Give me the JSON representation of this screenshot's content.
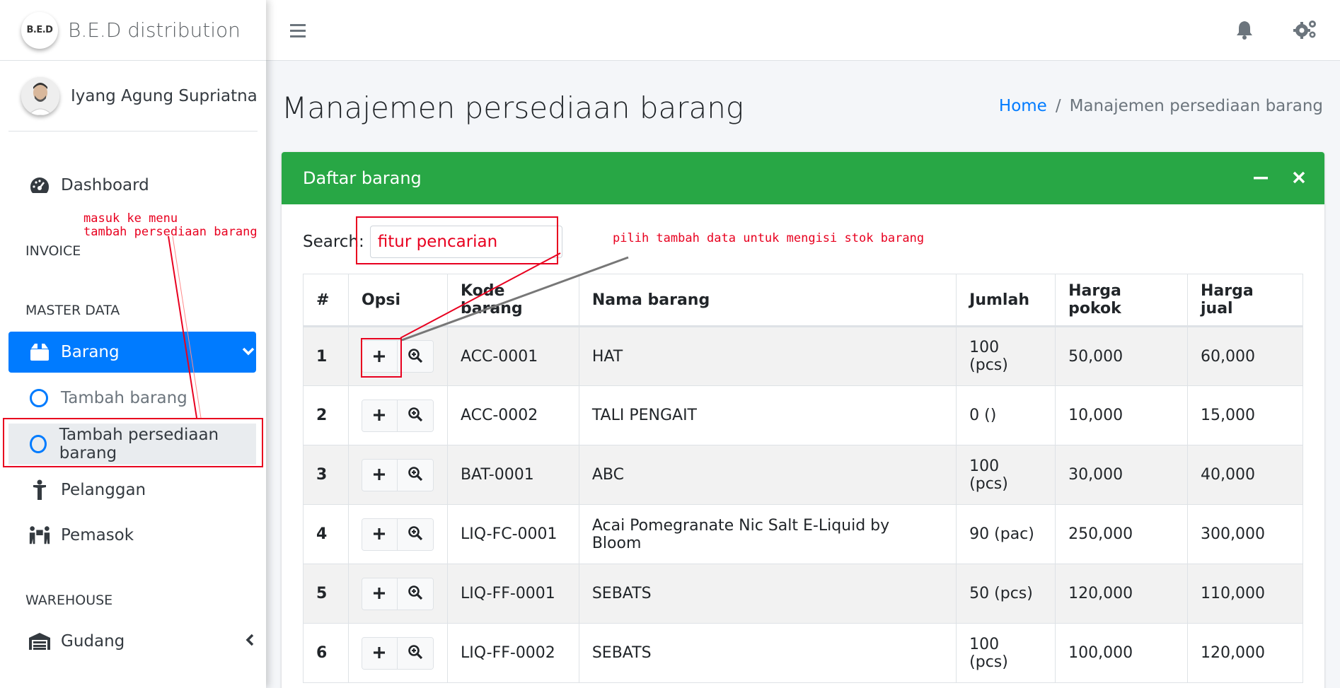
{
  "brand": {
    "logo_text": "B.E.D",
    "name": "B.E.D distribution"
  },
  "user": {
    "name": "Iyang Agung Supriatna"
  },
  "sidebar": {
    "items": [
      {
        "label": "Dashboard",
        "icon": "tachometer-icon"
      },
      {
        "header": "INVOICE"
      },
      {
        "header": "MASTER DATA"
      },
      {
        "label": "Barang",
        "icon": "box-icon",
        "active": true
      },
      {
        "label": "Tambah barang",
        "icon": "circle-icon"
      },
      {
        "label": "Tambah persediaan barang",
        "icon": "circle-icon"
      },
      {
        "label": "Pelanggan",
        "icon": "person-icon"
      },
      {
        "label": "Pemasok",
        "icon": "people-carry-icon"
      },
      {
        "header": "WAREHOUSE"
      },
      {
        "label": "Gudang",
        "icon": "warehouse-icon"
      }
    ]
  },
  "topbar": {
    "menu_icon": "hamburger-icon",
    "notification_icon": "bell-icon",
    "settings_icon": "gears-icon"
  },
  "page": {
    "title": "Manajemen persediaan barang",
    "breadcrumb": {
      "home": "Home",
      "current": "Manajemen persediaan barang"
    }
  },
  "card": {
    "title": "Daftar barang",
    "search_label": "Search:",
    "search_value": "fitur pencarian",
    "table": {
      "headers": [
        "#",
        "Opsi",
        "Kode barang",
        "Nama barang",
        "Jumlah",
        "Harga pokok",
        "Harga jual"
      ],
      "rows": [
        {
          "no": "1",
          "kode": "ACC-0001",
          "nama": "HAT",
          "jumlah": "100 (pcs)",
          "pokok": "50,000",
          "jual": "60,000"
        },
        {
          "no": "2",
          "kode": "ACC-0002",
          "nama": "TALI PENGAIT",
          "jumlah": "0 ()",
          "pokok": "10,000",
          "jual": "15,000"
        },
        {
          "no": "3",
          "kode": "BAT-0001",
          "nama": "ABC",
          "jumlah": "100 (pcs)",
          "pokok": "30,000",
          "jual": "40,000"
        },
        {
          "no": "4",
          "kode": "LIQ-FC-0001",
          "nama": "Acai Pomegranate Nic Salt E-Liquid by Bloom",
          "jumlah": "90 (pac)",
          "pokok": "250,000",
          "jual": "300,000"
        },
        {
          "no": "5",
          "kode": "LIQ-FF-0001",
          "nama": "SEBATS",
          "jumlah": "50 (pcs)",
          "pokok": "120,000",
          "jual": "110,000"
        },
        {
          "no": "6",
          "kode": "LIQ-FF-0002",
          "nama": "SEBATS",
          "jumlah": "100 (pcs)",
          "pokok": "100,000",
          "jual": "120,000"
        }
      ]
    }
  },
  "annotations": {
    "menu_note_line1": "masuk ke menu",
    "menu_note_line2": "tambah persediaan barang",
    "add_note": "pilih tambah data untuk mengisi stok barang",
    "color": "#e8001f"
  }
}
